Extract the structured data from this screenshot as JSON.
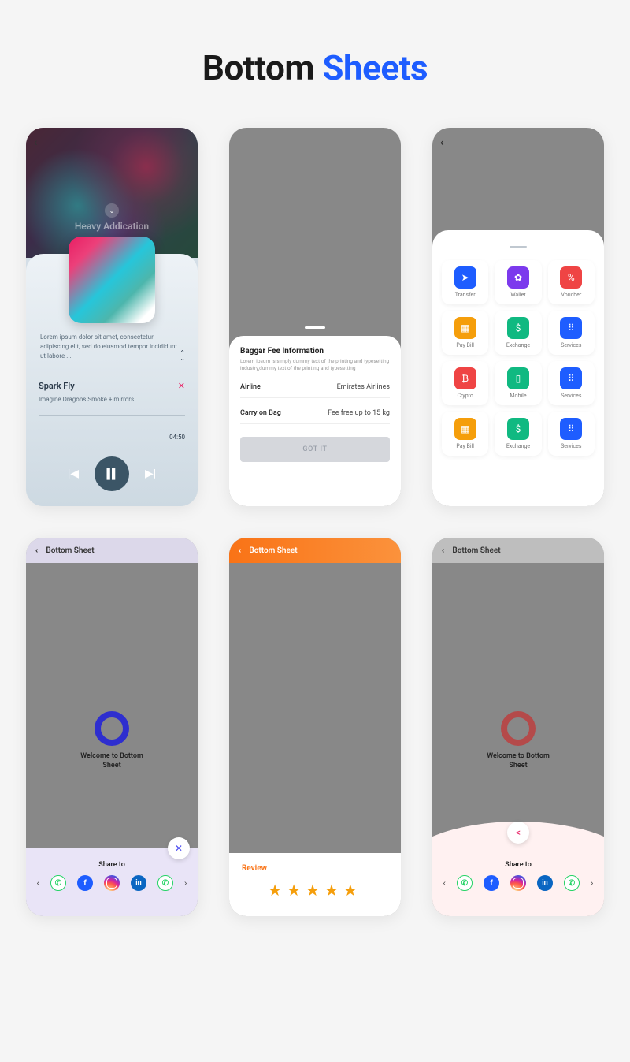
{
  "title": {
    "w1": "Bottom",
    "w2": "Sheets"
  },
  "card1": {
    "heroTitle": "Heavy Addication",
    "lorem": "Lorem ipsum dolor sit amet, consectetur adipiscing elit, sed do eiusmod tempor incididunt ut labore ...",
    "song": "Spark Fly",
    "artist": "Imagine Dragons Smoke + mirrors",
    "time": "04:50"
  },
  "card2": {
    "title": "Baggar Fee Information",
    "sub": "Lorem Ipsum is simply dummy text of the printing and typesetting industry,dummy text of the printing and typesetting",
    "rows": [
      {
        "k": "Airline",
        "v": "Emirates Airlines"
      },
      {
        "k": "Carry on Bag",
        "v": "Fee free up to 15 kg"
      }
    ],
    "button": "GOT IT"
  },
  "card3": {
    "items": [
      {
        "label": "Transfer",
        "color": "bg-blue",
        "glyph": "➤"
      },
      {
        "label": "Wallet",
        "color": "bg-purple",
        "glyph": "✿"
      },
      {
        "label": "Voucher",
        "color": "bg-red",
        "glyph": "%"
      },
      {
        "label": "Pay Bill",
        "color": "bg-amber",
        "glyph": "▦"
      },
      {
        "label": "Exchange",
        "color": "bg-green",
        "glyph": "$"
      },
      {
        "label": "Services",
        "color": "bg-blue",
        "glyph": "⠿"
      },
      {
        "label": "Crypto",
        "color": "bg-red",
        "glyph": "₿"
      },
      {
        "label": "Mobile",
        "color": "bg-green",
        "glyph": "▯"
      },
      {
        "label": "Services",
        "color": "bg-blue",
        "glyph": "⠿"
      },
      {
        "label": "Pay Bill",
        "color": "bg-amber",
        "glyph": "▦"
      },
      {
        "label": "Exchange",
        "color": "bg-green",
        "glyph": "$"
      },
      {
        "label": "Services",
        "color": "bg-blue",
        "glyph": "⠿"
      }
    ]
  },
  "card4": {
    "header": "Bottom Sheet",
    "welcome": "Welcome to Bottom\nSheet",
    "shareTitle": "Share to"
  },
  "card5": {
    "header": "Bottom Sheet",
    "reviewTitle": "Review",
    "stars": "★★★★★"
  },
  "card6": {
    "header": "Bottom Sheet",
    "welcome": "Welcome to Bottom\nSheet",
    "shareTitle": "Share to"
  }
}
